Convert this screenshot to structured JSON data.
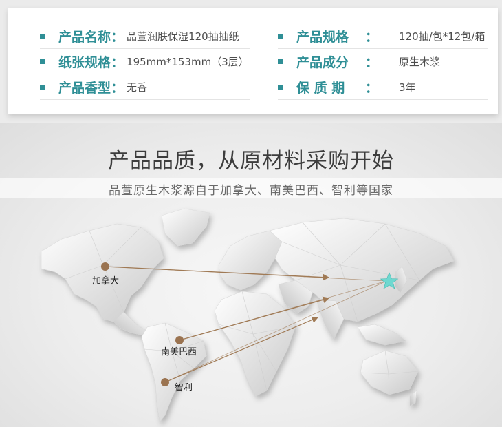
{
  "specs": {
    "left": [
      {
        "label": "产品名称",
        "value": "品萱润肤保湿120抽抽纸"
      },
      {
        "label": "纸张规格",
        "value": "195mm*153mm（3层）"
      },
      {
        "label": "产品香型",
        "value": "无香"
      }
    ],
    "right": [
      {
        "label": "产品规格",
        "value": "120抽/包*12包/箱"
      },
      {
        "label": "产品成分",
        "value": "原生木浆"
      },
      {
        "label": "保 质 期",
        "value": "3年"
      }
    ],
    "colon": "："
  },
  "quality": {
    "heading": "产品品质，从原材料采购开始",
    "subtitle": "品萱原生木浆源自于加拿大、南美巴西、智利等国家"
  },
  "map": {
    "origins": [
      {
        "name": "加拿大"
      },
      {
        "name": "南美巴西"
      },
      {
        "name": "智利"
      }
    ],
    "colors": {
      "origin_dot": "#9a7350",
      "arrow": "#a07a55",
      "destination_star": "#6fd8d0",
      "accent": "#2f8f96"
    },
    "destination_icon": "star-icon"
  }
}
